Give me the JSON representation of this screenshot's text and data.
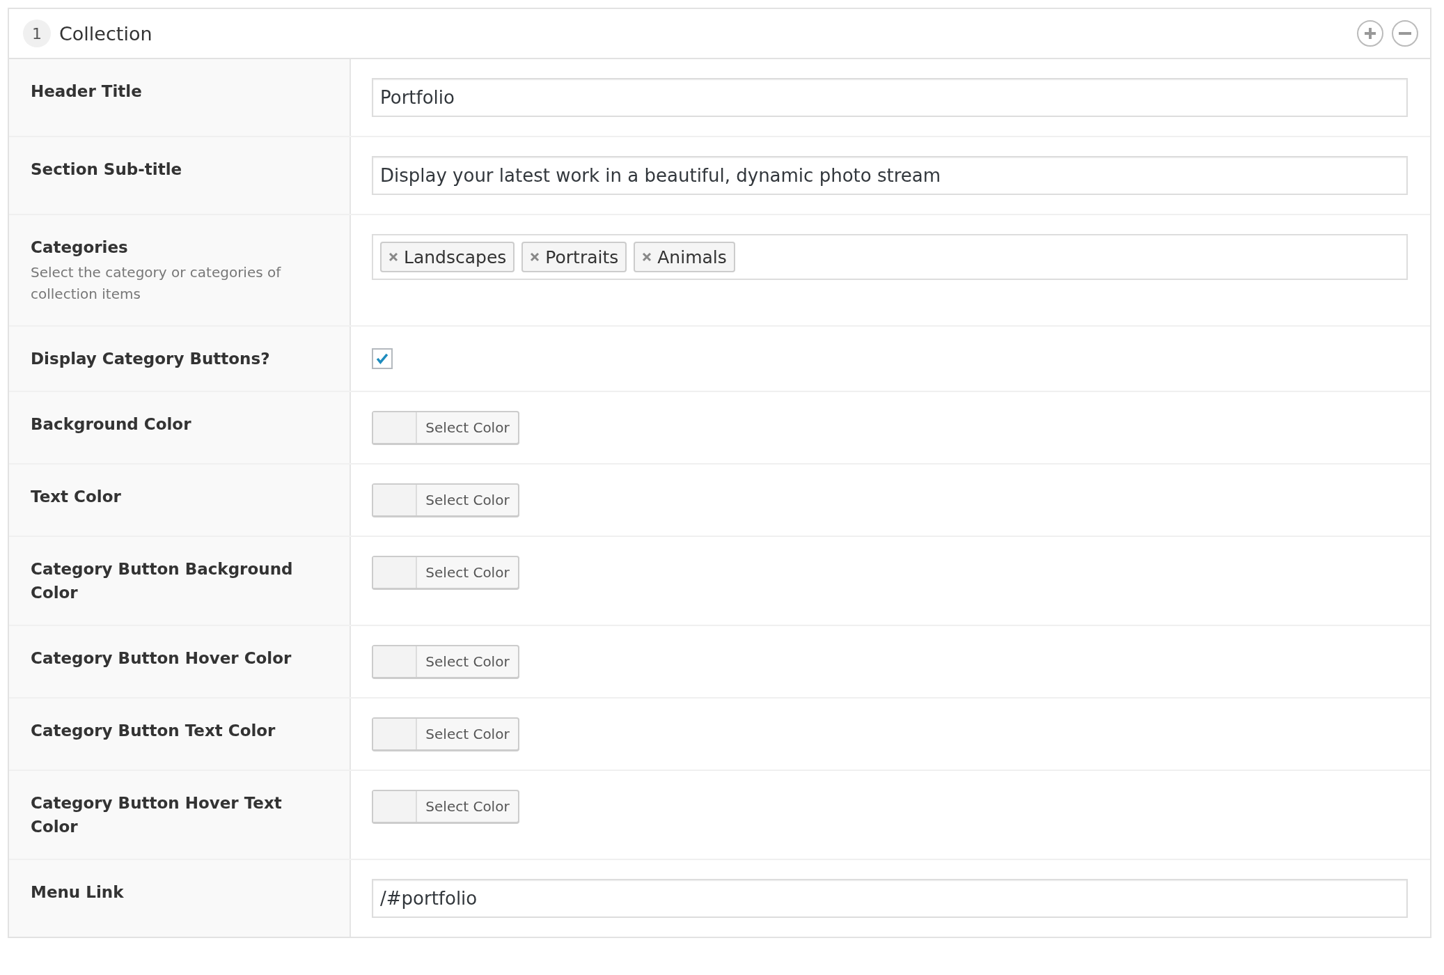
{
  "panel": {
    "number": "1",
    "title": "Collection"
  },
  "fields": [
    {
      "kind": "text",
      "label": "Header Title",
      "value": "Portfolio"
    },
    {
      "kind": "text",
      "label": "Section Sub-title",
      "value": "Display your latest work in a beautiful, dynamic photo stream"
    },
    {
      "kind": "tags",
      "label": "Categories",
      "description": "Select the category or categories of collection items",
      "tags": [
        "Landscapes",
        "Portraits",
        "Animals"
      ]
    },
    {
      "kind": "checkbox",
      "label": "Display Category Buttons?",
      "checked": true
    },
    {
      "kind": "color",
      "label": "Background Color",
      "button": "Select Color"
    },
    {
      "kind": "color",
      "label": "Text Color",
      "button": "Select Color"
    },
    {
      "kind": "color",
      "label": "Category Button Background Color",
      "button": "Select Color"
    },
    {
      "kind": "color",
      "label": "Category Button Hover Color",
      "button": "Select Color"
    },
    {
      "kind": "color",
      "label": "Category Button Text Color",
      "button": "Select Color"
    },
    {
      "kind": "color",
      "label": "Category Button Hover Text Color",
      "button": "Select Color"
    },
    {
      "kind": "text",
      "label": "Menu Link",
      "value": "/#portfolio"
    }
  ]
}
